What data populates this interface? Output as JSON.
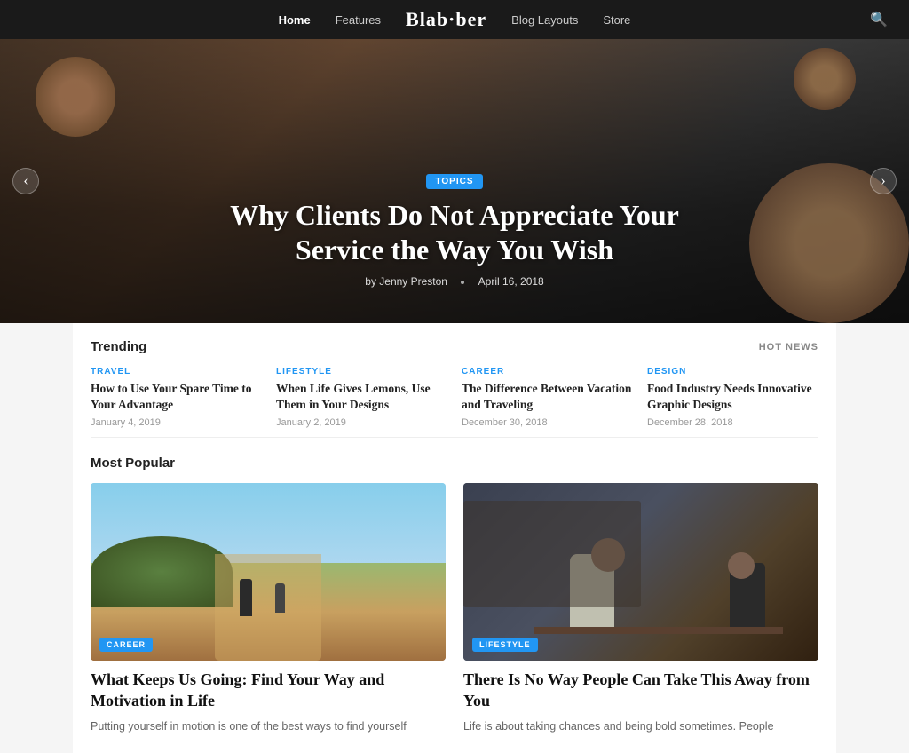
{
  "nav": {
    "logo": "Blab·ber",
    "links": [
      {
        "label": "Home",
        "active": true
      },
      {
        "label": "Features",
        "active": false
      },
      {
        "label": "Blog Layouts",
        "active": false
      },
      {
        "label": "Store",
        "active": false
      }
    ],
    "search_icon": "🔍"
  },
  "hero": {
    "badge": "TOPICS",
    "title": "Why Clients Do Not Appreciate Your Service the Way You Wish",
    "author": "by Jenny Preston",
    "date": "April 16, 2018",
    "arrow_left": "‹",
    "arrow_right": "›"
  },
  "trending": {
    "section_title": "Trending",
    "hot_news_label": "HOT NEWS",
    "items": [
      {
        "category": "TRAVEL",
        "cat_class": "cat-travel",
        "title": "How to Use Your Spare Time to Your Advantage",
        "date": "January 4, 2019"
      },
      {
        "category": "LIFESTYLE",
        "cat_class": "cat-lifestyle",
        "title": "When Life Gives Lemons, Use Them in Your Designs",
        "date": "January 2, 2019"
      },
      {
        "category": "CAREER",
        "cat_class": "cat-career",
        "title": "The Difference Between Vacation and Traveling",
        "date": "December 30, 2018"
      },
      {
        "category": "DESIGN",
        "cat_class": "cat-design",
        "title": "Food Industry Needs Innovative Graphic Designs",
        "date": "December 28, 2018"
      }
    ]
  },
  "most_popular": {
    "section_title": "Most Popular",
    "cards": [
      {
        "category": "CAREER",
        "title": "What Keeps Us Going: Find Your Way and Motivation in Life",
        "description": "Putting yourself in motion is one of the best ways to find yourself",
        "img_type": "running"
      },
      {
        "category": "LIFESTYLE",
        "title": "There Is No Way People Can Take This Away from You",
        "description": "Life is about taking chances and being bold sometimes. People",
        "img_type": "workshop"
      }
    ]
  }
}
